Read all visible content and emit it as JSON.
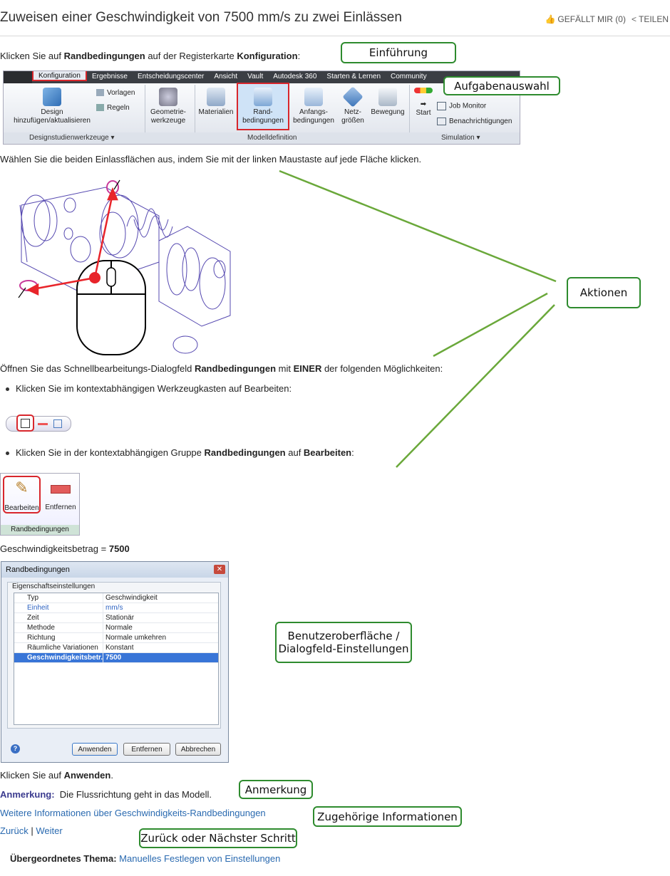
{
  "header": {
    "title": "Zuweisen einer Geschwindigkeit von 7500 mm/s zu zwei Einlässen",
    "like_label": "GEFÄLLT MIR (0)",
    "share_label": "TEILEN"
  },
  "intro": {
    "pre": "Klicken Sie auf ",
    "b1": "Randbedingungen",
    "mid": " auf der Registerkarte ",
    "b2": "Konfiguration",
    "post": ":"
  },
  "ribbon": {
    "tabs": [
      "Konfiguration",
      "Ergebnisse",
      "Entscheidungscenter",
      "Ansicht",
      "Vault",
      "Autodesk 360",
      "Starten & Lernen",
      "Community"
    ],
    "tools": {
      "design": "Design hinzufügen/aktualisieren",
      "vorlagen": "Vorlagen",
      "regeln": "Regeln",
      "geometrie": "Geometrie- werkzeuge",
      "materialien": "Materialien",
      "rand": "Rand- bedingungen",
      "anfangs": "Anfangs- bedingungen",
      "netz": "Netz- größen",
      "bewegung": "Bewegung",
      "start": "Start",
      "job": "Job Monitor",
      "benach": "Benachrichtigungen"
    },
    "groups": [
      "Designstudienwerkzeuge ▾",
      "Modelldefinition",
      "Simulation ▾"
    ]
  },
  "step_select": "Wählen Sie die beiden Einlassflächen aus, indem Sie mit der linken Maustaste auf jede Fläche klicken.",
  "step_open": {
    "pre": "Öffnen Sie das Schnellbearbeitungs-Dialogfeld ",
    "b1": "Randbedingungen",
    "mid": " mit ",
    "b2": "EINER",
    "post": " der folgenden Möglichkeiten:"
  },
  "bullet1": "Klicken Sie im kontextabhängigen Werkzeugkasten auf Bearbeiten:",
  "bullet2": {
    "pre": "Klicken Sie in der kontextabhängigen Gruppe ",
    "b1": "Randbedingungen",
    "mid": " auf ",
    "b2": "Bearbeiten",
    "post": ":"
  },
  "panel": {
    "edit": "Bearbeiten",
    "remove": "Entfernen",
    "group": "Randbedingungen"
  },
  "magnitude": {
    "pre": "Geschwindigkeitsbetrag = ",
    "value": "7500"
  },
  "dialog": {
    "title": "Randbedingungen",
    "group": "Eigenschaftseinstellungen",
    "rows": [
      {
        "k": "Typ",
        "v": "Geschwindigkeit"
      },
      {
        "k": "Einheit",
        "v": "mm/s"
      },
      {
        "k": "Zeit",
        "v": "Stationär"
      },
      {
        "k": "Methode",
        "v": "Normale"
      },
      {
        "k": "Richtung",
        "v": "Normale umkehren"
      },
      {
        "k": "Räumliche Variationen",
        "v": "Konstant"
      },
      {
        "k": "Geschwindigkeitsbetr...",
        "v": "7500"
      }
    ],
    "buttons": [
      "Anwenden",
      "Entfernen",
      "Abbrechen"
    ]
  },
  "apply": {
    "pre": "Klicken Sie auf ",
    "b1": "Anwenden",
    "post": "."
  },
  "note": {
    "label": "Anmerkung:",
    "text": "Die Flussrichtung geht in das Modell."
  },
  "more_info": "Weitere Informationen über Geschwindigkeits-Randbedingungen",
  "nav": {
    "back": "Zurück",
    "sep": "|",
    "next": "Weiter"
  },
  "parent": {
    "label": "Übergeordnetes Thema:",
    "link": "Manuelles Festlegen von Einstellungen"
  },
  "callouts": {
    "intro": "Einführung",
    "task": "Aufgabenauswahl",
    "actions": "Aktionen",
    "ui": "Benutzeroberfläche / Dialogfeld-Einstellungen",
    "note": "Anmerkung",
    "related": "Zugehörige Informationen",
    "backnext": "Zurück oder Nächster Schritt"
  },
  "colors": {
    "callout_border": "#2e8b2e",
    "link": "#2a6ab0",
    "highlight": "#d8262c"
  }
}
